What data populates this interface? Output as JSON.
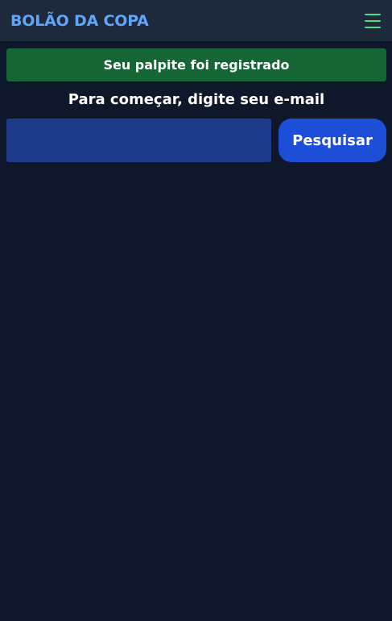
{
  "header": {
    "brand": "BOLÃO DA COPA",
    "menu_icon": "hamburger-menu-icon"
  },
  "banner": {
    "message": "Seu palpite foi registrado"
  },
  "prompt": {
    "text": "Para começar, digite seu e-mail"
  },
  "search": {
    "email_value": "",
    "button_label": "Pesquisar"
  },
  "colors": {
    "background": "#0f172a",
    "header": "#1e293b",
    "brand": "#60a5fa",
    "menu": "#4ade80",
    "success": "#166534",
    "input": "#1e3a8a",
    "button": "#1d4ed8"
  }
}
